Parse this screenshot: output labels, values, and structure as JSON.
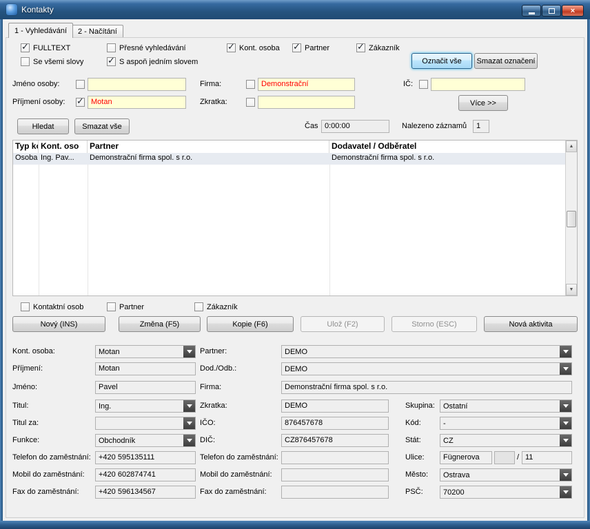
{
  "window": {
    "title": "Kontakty",
    "close_glyph": "×"
  },
  "tabs": {
    "vyhledavani": "1 - Vyhledávání",
    "nacitani": "2 - Načítání"
  },
  "search_options": {
    "fulltext": {
      "label": "FULLTEXT",
      "checked": true
    },
    "presne_vyhledavani": {
      "label": "Přesné vyhledávání",
      "checked": false
    },
    "kont_osoba": {
      "label": "Kont. osoba",
      "checked": true
    },
    "partner": {
      "label": "Partner",
      "checked": true
    },
    "zakaznik": {
      "label": "Zákazník",
      "checked": true
    },
    "se_vsemi_slovy": {
      "label": "Se všemi slovy",
      "checked": false
    },
    "s_aspon_jednim_slovem": {
      "label": "S aspoň jedním slovem",
      "checked": true
    }
  },
  "selection_buttons": {
    "oznacit_vse": "Označit vše",
    "smazat_oznaceni": "Smazat označení"
  },
  "search_form": {
    "jmeno_osoby": {
      "label": "Jméno osoby:",
      "checked": false,
      "value": ""
    },
    "prijmeni_osoby": {
      "label": "Příjmení osoby:",
      "checked": true,
      "value": "Motan"
    },
    "firma": {
      "label": "Firma:",
      "checked": false,
      "value": "Demonstrační"
    },
    "zkratka": {
      "label": "Zkratka:",
      "checked": false,
      "value": ""
    },
    "ic": {
      "label": "IČ:",
      "checked": false,
      "value": ""
    },
    "vice_button": "Více >>"
  },
  "search_actions": {
    "hledat": "Hledat",
    "smazat_vse": "Smazat vše",
    "cas_label": "Čas",
    "cas_value": "0:00:00",
    "nalezeno_label": "Nalezeno záznamů",
    "nalezeno_value": "1"
  },
  "results_table": {
    "headers": {
      "typ": "Typ kon",
      "kont_osoba": "Kont. oso",
      "partner": "Partner",
      "dodavatel": "Dodavatel / Odběratel"
    },
    "rows": [
      {
        "typ": "Osoba",
        "kont_osoba": "Ing. Pav...",
        "partner": "Demonstrační firma spol. s r.o.",
        "dodavatel": "Demonstrační firma spol. s r.o."
      }
    ]
  },
  "record_filters": {
    "kontaktni_osob": {
      "label": "Kontaktní osob",
      "checked": false
    },
    "partner": {
      "label": "Partner",
      "checked": false
    },
    "zakaznik": {
      "label": "Zákazník",
      "checked": false
    }
  },
  "record_actions": {
    "novy": "Nový (INS)",
    "zmena": "Změna (F5)",
    "kopie": "Kopie (F6)",
    "uloz": "Ulož (F2)",
    "storno": "Storno (ESC)",
    "nova_aktivita": "Nová aktivita"
  },
  "detail_form": {
    "kont_osoba": {
      "label": "Kont. osoba:",
      "value": "Motan"
    },
    "prijmeni": {
      "label": "Příjmení:",
      "value": "Motan"
    },
    "jmeno": {
      "label": "Jméno:",
      "value": "Pavel"
    },
    "titul": {
      "label": "Titul:",
      "value": "Ing."
    },
    "titul_za": {
      "label": "Titul za:",
      "value": ""
    },
    "funkce": {
      "label": "Funkce:",
      "value": "Obchodník"
    },
    "telefon_zam": {
      "label": "Telefon do zaměstnání:",
      "value": "+420 595135111"
    },
    "mobil_zam": {
      "label": "Mobil do zaměstnání:",
      "value": "+420 602874741"
    },
    "fax_zam": {
      "label": "Fax do zaměstnání:",
      "value": "+420 596134567"
    },
    "partner": {
      "label": "Partner:",
      "value": "DEMO"
    },
    "dod_odb": {
      "label": "Dod./Odb.:",
      "value": "DEMO"
    },
    "firma": {
      "label": "Firma:",
      "value": "Demonstrační firma spol. s r.o."
    },
    "zkratka": {
      "label": "Zkratka:",
      "value": "DEMO"
    },
    "ico": {
      "label": "IČO:",
      "value": "876457678"
    },
    "dic": {
      "label": "DIČ:",
      "value": "CZ876457678"
    },
    "telefon_zam2": {
      "label": "Telefon do zaměstnání:",
      "value": ""
    },
    "mobil_zam2": {
      "label": "Mobil do zaměstnání:",
      "value": ""
    },
    "fax_zam2": {
      "label": "Fax do zaměstnání:",
      "value": ""
    },
    "skupina": {
      "label": "Skupina:",
      "value": "Ostatní"
    },
    "kod": {
      "label": "Kód:",
      "value": "-"
    },
    "stat": {
      "label": "Stát:",
      "value": "CZ"
    },
    "ulice": {
      "label": "Ulice:",
      "value": "Fügnerova",
      "cislo_popisne": "",
      "separator": "/",
      "cislo_orientacni": "11"
    },
    "mesto": {
      "label": "Město:",
      "value": "Ostrava"
    },
    "psc": {
      "label": "PSČ:",
      "value": "70200"
    }
  }
}
